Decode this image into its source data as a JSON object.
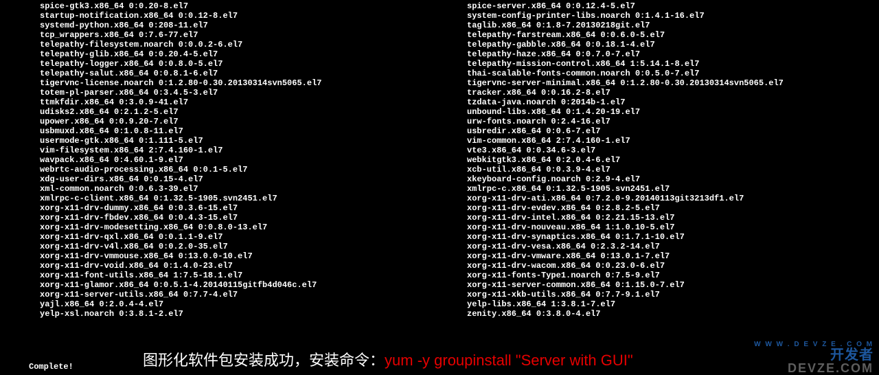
{
  "left_packages": [
    "spice-gtk3.x86_64 0:0.20-8.el7",
    "startup-notification.x86_64 0:0.12-8.el7",
    "systemd-python.x86_64 0:208-11.el7",
    "tcp_wrappers.x86_64 0:7.6-77.el7",
    "telepathy-filesystem.noarch 0:0.0.2-6.el7",
    "telepathy-glib.x86_64 0:0.20.4-5.el7",
    "telepathy-logger.x86_64 0:0.8.0-5.el7",
    "telepathy-salut.x86_64 0:0.8.1-6.el7",
    "tigervnc-license.noarch 0:1.2.80-0.30.20130314svn5065.el7",
    "totem-pl-parser.x86_64 0:3.4.5-3.el7",
    "ttmkfdir.x86_64 0:3.0.9-41.el7",
    "udisks2.x86_64 0:2.1.2-5.el7",
    "upower.x86_64 0:0.9.20-7.el7",
    "usbmuxd.x86_64 0:1.0.8-11.el7",
    "usermode-gtk.x86_64 0:1.111-5.el7",
    "vim-filesystem.x86_64 2:7.4.160-1.el7",
    "wavpack.x86_64 0:4.60.1-9.el7",
    "webrtc-audio-processing.x86_64 0:0.1-5.el7",
    "xdg-user-dirs.x86_64 0:0.15-4.el7",
    "xml-common.noarch 0:0.6.3-39.el7",
    "xmlrpc-c-client.x86_64 0:1.32.5-1905.svn2451.el7",
    "xorg-x11-drv-dummy.x86_64 0:0.3.6-15.el7",
    "xorg-x11-drv-fbdev.x86_64 0:0.4.3-15.el7",
    "xorg-x11-drv-modesetting.x86_64 0:0.8.0-13.el7",
    "xorg-x11-drv-qxl.x86_64 0:0.1.1-9.el7",
    "xorg-x11-drv-v4l.x86_64 0:0.2.0-35.el7",
    "xorg-x11-drv-vmmouse.x86_64 0:13.0.0-10.el7",
    "xorg-x11-drv-void.x86_64 0:1.4.0-23.el7",
    "xorg-x11-font-utils.x86_64 1:7.5-18.1.el7",
    "xorg-x11-glamor.x86_64 0:0.5.1-4.20140115gitfb4d046c.el7",
    "xorg-x11-server-utils.x86_64 0:7.7-4.el7",
    "yajl.x86_64 0:2.0.4-4.el7",
    "yelp-xsl.noarch 0:3.8.1-2.el7"
  ],
  "right_packages": [
    "spice-server.x86_64 0:0.12.4-5.el7",
    "system-config-printer-libs.noarch 0:1.4.1-16.el7",
    "taglib.x86_64 0:1.8-7.20130218git.el7",
    "telepathy-farstream.x86_64 0:0.6.0-5.el7",
    "telepathy-gabble.x86_64 0:0.18.1-4.el7",
    "telepathy-haze.x86_64 0:0.7.0-7.el7",
    "telepathy-mission-control.x86_64 1:5.14.1-8.el7",
    "thai-scalable-fonts-common.noarch 0:0.5.0-7.el7",
    "tigervnc-server-minimal.x86_64 0:1.2.80-0.30.20130314svn5065.el7",
    "tracker.x86_64 0:0.16.2-8.el7",
    "tzdata-java.noarch 0:2014b-1.el7",
    "unbound-libs.x86_64 0:1.4.20-19.el7",
    "urw-fonts.noarch 0:2.4-16.el7",
    "usbredir.x86_64 0:0.6-7.el7",
    "vim-common.x86_64 2:7.4.160-1.el7",
    "vte3.x86_64 0:0.34.6-3.el7",
    "webkitgtk3.x86_64 0:2.0.4-6.el7",
    "xcb-util.x86_64 0:0.3.9-4.el7",
    "xkeyboard-config.noarch 0:2.9-4.el7",
    "xmlrpc-c.x86_64 0:1.32.5-1905.svn2451.el7",
    "xorg-x11-drv-ati.x86_64 0:7.2.0-9.20140113git3213df1.el7",
    "xorg-x11-drv-evdev.x86_64 0:2.8.2-5.el7",
    "xorg-x11-drv-intel.x86_64 0:2.21.15-13.el7",
    "xorg-x11-drv-nouveau.x86_64 1:1.0.10-5.el7",
    "xorg-x11-drv-synaptics.x86_64 0:1.7.1-10.el7",
    "xorg-x11-drv-vesa.x86_64 0:2.3.2-14.el7",
    "xorg-x11-drv-vmware.x86_64 0:13.0.1-7.el7",
    "xorg-x11-drv-wacom.x86_64 0:0.23.0-6.el7",
    "xorg-x11-fonts-Type1.noarch 0:7.5-9.el7",
    "xorg-x11-server-common.x86_64 0:1.15.0-7.el7",
    "xorg-x11-xkb-utils.x86_64 0:7.7-9.1.el7",
    "yelp-libs.x86_64 1:3.8.1-7.el7",
    "zenity.x86_64 0:3.8.0-4.el7"
  ],
  "complete_text": "Complete!",
  "annotation": {
    "white": "图形化软件包安装成功，安装命令：",
    "red": "yum  -y  groupinstall  \"Server with GUI\""
  },
  "watermark": {
    "top": "开发者",
    "url": "W W W . D E V Z E . C O M",
    "bottom": "DEVZE.COM"
  }
}
